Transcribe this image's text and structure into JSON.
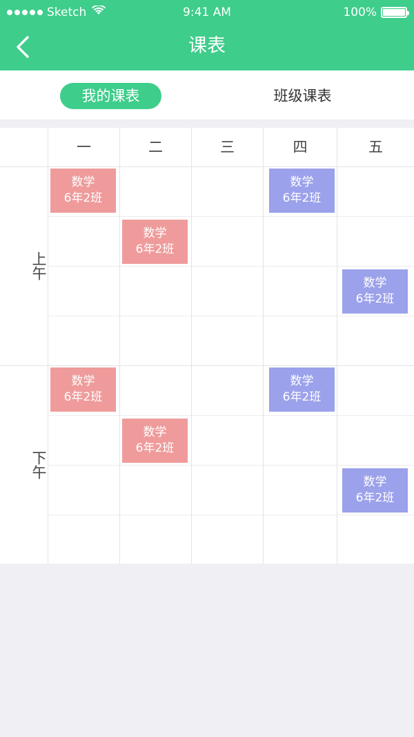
{
  "status_bar": {
    "carrier": "Sketch",
    "time": "9:41 AM",
    "battery": "100%"
  },
  "nav": {
    "title": "课表",
    "back_icon": "chevron-left-icon"
  },
  "tabs": [
    {
      "label": "我的课表",
      "active": true
    },
    {
      "label": "班级课表",
      "active": false
    }
  ],
  "timetable": {
    "days": [
      "一",
      "二",
      "三",
      "四",
      "五"
    ],
    "periods": [
      "上午",
      "下午"
    ],
    "morning_label": "上午",
    "afternoon_label": "下午",
    "colors": {
      "accent": "#3ecd8b",
      "red_course": "#ef9b9b",
      "blue_course": "#9ba1ea"
    },
    "courses": [
      {
        "subject": "数学",
        "class": "6年2班"
      },
      {
        "subject": "数学",
        "class": "6年2班"
      },
      {
        "subject": "数学",
        "class": "6年2班"
      },
      {
        "subject": "数学",
        "class": "6年2班"
      },
      {
        "subject": "数学",
        "class": "6年2班"
      },
      {
        "subject": "数学",
        "class": "6年2班"
      },
      {
        "subject": "数学",
        "class": "6年2班"
      },
      {
        "subject": "数学",
        "class": "6年2班"
      }
    ]
  }
}
